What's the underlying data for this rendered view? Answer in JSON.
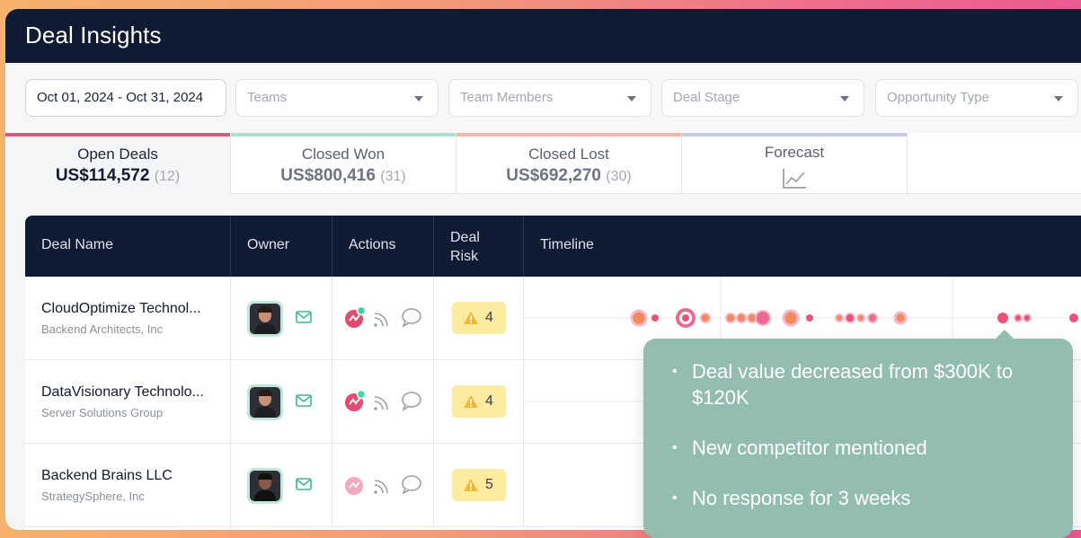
{
  "app": {
    "title": "Deal Insights"
  },
  "filters": {
    "date_range": "Oct 01, 2024 - Oct 31, 2024",
    "teams": "Teams",
    "team_members": "Team Members",
    "deal_stage": "Deal Stage",
    "opportunity_type": "Opportunity Type"
  },
  "tabs": [
    {
      "label": "Open Deals",
      "value": "US$114,572",
      "count": "(12)",
      "color": "#e8537a"
    },
    {
      "label": "Closed Won",
      "value": "US$800,416",
      "count": "(31)",
      "color": "#7fd6b8"
    },
    {
      "label": "Closed Lost",
      "value": "US$692,270",
      "count": "(30)",
      "color": "#f29a8a"
    },
    {
      "label": "Forecast",
      "icon": "line-chart-icon",
      "color": "#b8bde0"
    }
  ],
  "table": {
    "headers": {
      "deal_name": "Deal Name",
      "owner": "Owner",
      "actions": "Actions",
      "deal_risk": "Deal Risk",
      "timeline": "Timeline"
    },
    "rows": [
      {
        "name": "CloudOptimize Technol...",
        "company": "Backend Architects, Inc",
        "risk": "4"
      },
      {
        "name": "DataVisionary Technolo...",
        "company": "Server Solutions Group",
        "risk": "4"
      },
      {
        "name": "Backend Brains LLC",
        "company": "StrategySphere, Inc",
        "risk": "5"
      }
    ]
  },
  "tooltip": {
    "items": [
      "Deal value decreased from $300K to $120K",
      "New competitor mentioned",
      "No response for 3 weeks"
    ]
  },
  "colors": {
    "header": "#0f1a33",
    "accent": "#e8537a",
    "risk_badge": "#fdeca0",
    "tooltip": "#94bdb1"
  }
}
